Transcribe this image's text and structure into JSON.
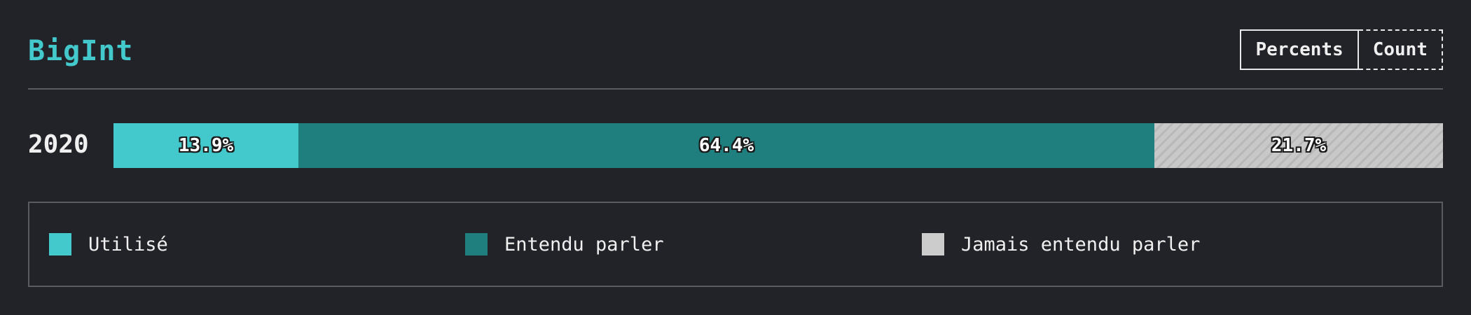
{
  "header": {
    "title": "BigInt",
    "toggle": {
      "percents_label": "Percents",
      "count_label": "Count",
      "selected": "Percents"
    }
  },
  "colors": {
    "accent": "#43c9cb",
    "used": "#43c9cb",
    "heard": "#1f7f7f",
    "never": "#cccccc",
    "background": "#222329"
  },
  "chart_data": {
    "type": "bar",
    "orientation": "horizontal-stacked",
    "categories": [
      "2020"
    ],
    "series": [
      {
        "name": "Utilisé",
        "values": [
          13.9
        ],
        "label": "13.9%",
        "color": "#43c9cb"
      },
      {
        "name": "Entendu parler",
        "values": [
          64.4
        ],
        "label": "64.4%",
        "color": "#1f7f7f"
      },
      {
        "name": "Jamais entendu parler",
        "values": [
          21.7
        ],
        "label": "21.7%",
        "color": "#cccccc"
      }
    ],
    "title": "BigInt",
    "xlim": [
      0,
      100
    ],
    "grid": false,
    "legend": "bottom"
  }
}
